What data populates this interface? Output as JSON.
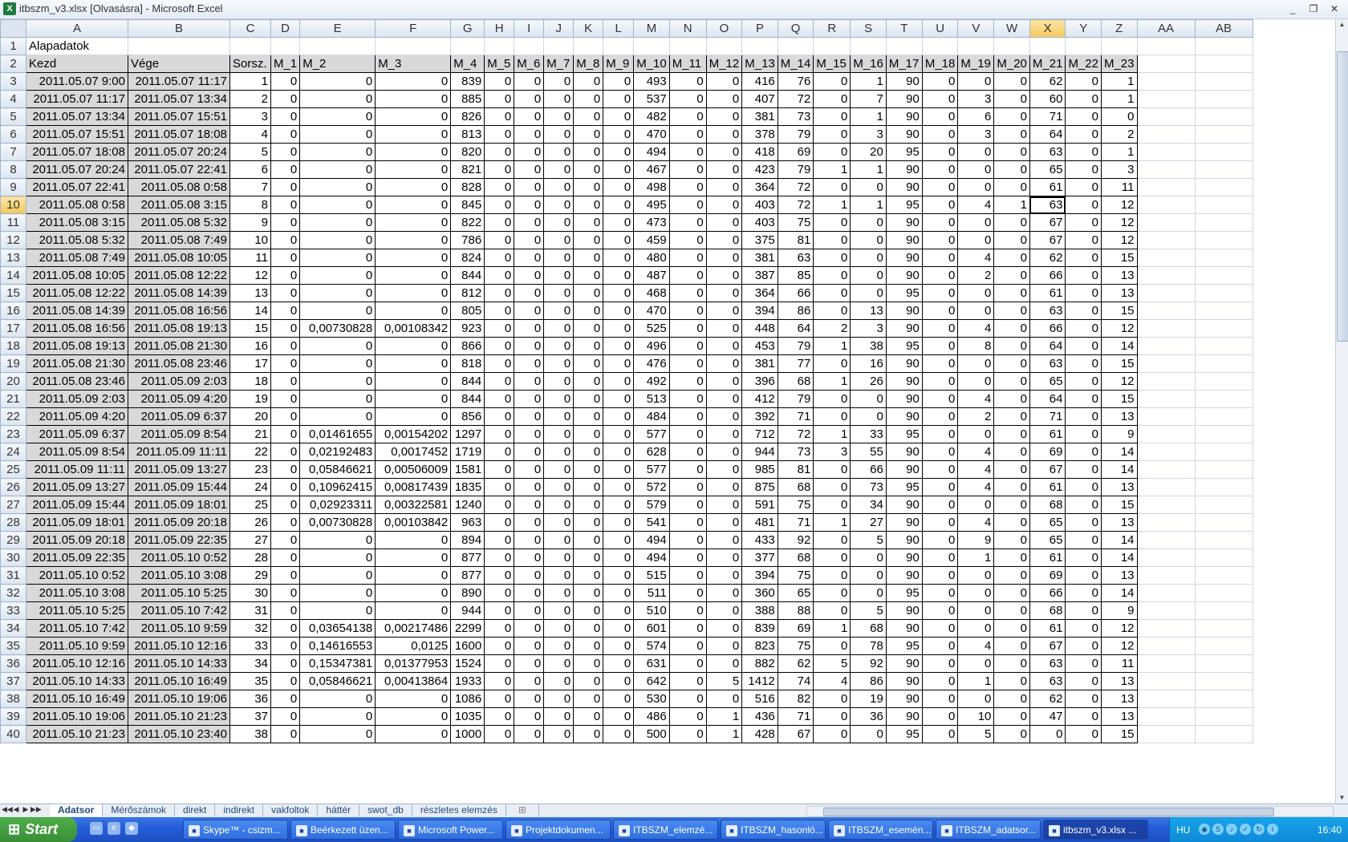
{
  "window": {
    "title": "itbszm_v3.xlsx  [Olvasásra] - Microsoft Excel",
    "minimize": "_",
    "restore": "❐",
    "close": "✕"
  },
  "columns": [
    "A",
    "B",
    "C",
    "D",
    "E",
    "F",
    "G",
    "H",
    "I",
    "J",
    "K",
    "L",
    "M",
    "N",
    "O",
    "P",
    "Q",
    "R",
    "S",
    "T",
    "U",
    "V",
    "W",
    "X",
    "Y",
    "Z",
    "AA",
    "AB"
  ],
  "active_column": "X",
  "active_row": "10",
  "row1": {
    "num": "1",
    "text": "Alapadatok"
  },
  "row2": {
    "num": "2",
    "headers": [
      "Kezd",
      "Vége",
      "Sorsz.",
      "M_1",
      "M_2",
      "M_3",
      "M_4",
      "M_5",
      "M_6",
      "M_7",
      "M_8",
      "M_9",
      "M_10",
      "M_11",
      "M_12",
      "M_13",
      "M_14",
      "M_15",
      "M_16",
      "M_17",
      "M_18",
      "M_19",
      "M_20",
      "M_21",
      "M_22",
      "M_23"
    ]
  },
  "rows": [
    [
      "3",
      "2011.05.07 9:00",
      "2011.05.07 11:17",
      "1",
      "0",
      "0",
      "0",
      "839",
      "0",
      "0",
      "0",
      "0",
      "0",
      "493",
      "0",
      "0",
      "416",
      "76",
      "0",
      "1",
      "90",
      "0",
      "0",
      "0",
      "62",
      "0",
      "1"
    ],
    [
      "4",
      "2011.05.07 11:17",
      "2011.05.07 13:34",
      "2",
      "0",
      "0",
      "0",
      "885",
      "0",
      "0",
      "0",
      "0",
      "0",
      "537",
      "0",
      "0",
      "407",
      "72",
      "0",
      "7",
      "90",
      "0",
      "3",
      "0",
      "60",
      "0",
      "1"
    ],
    [
      "5",
      "2011.05.07 13:34",
      "2011.05.07 15:51",
      "3",
      "0",
      "0",
      "0",
      "826",
      "0",
      "0",
      "0",
      "0",
      "0",
      "482",
      "0",
      "0",
      "381",
      "73",
      "0",
      "1",
      "90",
      "0",
      "6",
      "0",
      "71",
      "0",
      "0"
    ],
    [
      "6",
      "2011.05.07 15:51",
      "2011.05.07 18:08",
      "4",
      "0",
      "0",
      "0",
      "813",
      "0",
      "0",
      "0",
      "0",
      "0",
      "470",
      "0",
      "0",
      "378",
      "79",
      "0",
      "3",
      "90",
      "0",
      "3",
      "0",
      "64",
      "0",
      "2"
    ],
    [
      "7",
      "2011.05.07 18:08",
      "2011.05.07 20:24",
      "5",
      "0",
      "0",
      "0",
      "820",
      "0",
      "0",
      "0",
      "0",
      "0",
      "494",
      "0",
      "0",
      "418",
      "69",
      "0",
      "20",
      "95",
      "0",
      "0",
      "0",
      "63",
      "0",
      "1"
    ],
    [
      "8",
      "2011.05.07 20:24",
      "2011.05.07 22:41",
      "6",
      "0",
      "0",
      "0",
      "821",
      "0",
      "0",
      "0",
      "0",
      "0",
      "467",
      "0",
      "0",
      "423",
      "79",
      "1",
      "1",
      "90",
      "0",
      "0",
      "0",
      "65",
      "0",
      "3"
    ],
    [
      "9",
      "2011.05.07 22:41",
      "2011.05.08 0:58",
      "7",
      "0",
      "0",
      "0",
      "828",
      "0",
      "0",
      "0",
      "0",
      "0",
      "498",
      "0",
      "0",
      "364",
      "72",
      "0",
      "0",
      "90",
      "0",
      "0",
      "0",
      "61",
      "0",
      "11"
    ],
    [
      "10",
      "2011.05.08 0:58",
      "2011.05.08 3:15",
      "8",
      "0",
      "0",
      "0",
      "845",
      "0",
      "0",
      "0",
      "0",
      "0",
      "495",
      "0",
      "0",
      "403",
      "72",
      "1",
      "1",
      "95",
      "0",
      "4",
      "1",
      "63",
      "0",
      "12"
    ],
    [
      "11",
      "2011.05.08 3:15",
      "2011.05.08 5:32",
      "9",
      "0",
      "0",
      "0",
      "822",
      "0",
      "0",
      "0",
      "0",
      "0",
      "473",
      "0",
      "0",
      "403",
      "75",
      "0",
      "0",
      "90",
      "0",
      "0",
      "0",
      "67",
      "0",
      "12"
    ],
    [
      "12",
      "2011.05.08 5:32",
      "2011.05.08 7:49",
      "10",
      "0",
      "0",
      "0",
      "786",
      "0",
      "0",
      "0",
      "0",
      "0",
      "459",
      "0",
      "0",
      "375",
      "81",
      "0",
      "0",
      "90",
      "0",
      "0",
      "0",
      "67",
      "0",
      "12"
    ],
    [
      "13",
      "2011.05.08 7:49",
      "2011.05.08 10:05",
      "11",
      "0",
      "0",
      "0",
      "824",
      "0",
      "0",
      "0",
      "0",
      "0",
      "480",
      "0",
      "0",
      "381",
      "63",
      "0",
      "0",
      "90",
      "0",
      "4",
      "0",
      "62",
      "0",
      "15"
    ],
    [
      "14",
      "2011.05.08 10:05",
      "2011.05.08 12:22",
      "12",
      "0",
      "0",
      "0",
      "844",
      "0",
      "0",
      "0",
      "0",
      "0",
      "487",
      "0",
      "0",
      "387",
      "85",
      "0",
      "0",
      "90",
      "0",
      "2",
      "0",
      "66",
      "0",
      "13"
    ],
    [
      "15",
      "2011.05.08 12:22",
      "2011.05.08 14:39",
      "13",
      "0",
      "0",
      "0",
      "812",
      "0",
      "0",
      "0",
      "0",
      "0",
      "468",
      "0",
      "0",
      "364",
      "66",
      "0",
      "0",
      "95",
      "0",
      "0",
      "0",
      "61",
      "0",
      "13"
    ],
    [
      "16",
      "2011.05.08 14:39",
      "2011.05.08 16:56",
      "14",
      "0",
      "0",
      "0",
      "805",
      "0",
      "0",
      "0",
      "0",
      "0",
      "470",
      "0",
      "0",
      "394",
      "86",
      "0",
      "13",
      "90",
      "0",
      "0",
      "0",
      "63",
      "0",
      "15"
    ],
    [
      "17",
      "2011.05.08 16:56",
      "2011.05.08 19:13",
      "15",
      "0",
      "0,00730828",
      "0,00108342",
      "923",
      "0",
      "0",
      "0",
      "0",
      "0",
      "525",
      "0",
      "0",
      "448",
      "64",
      "2",
      "3",
      "90",
      "0",
      "4",
      "0",
      "66",
      "0",
      "12"
    ],
    [
      "18",
      "2011.05.08 19:13",
      "2011.05.08 21:30",
      "16",
      "0",
      "0",
      "0",
      "866",
      "0",
      "0",
      "0",
      "0",
      "0",
      "496",
      "0",
      "0",
      "453",
      "79",
      "1",
      "38",
      "95",
      "0",
      "8",
      "0",
      "64",
      "0",
      "14"
    ],
    [
      "19",
      "2011.05.08 21:30",
      "2011.05.08 23:46",
      "17",
      "0",
      "0",
      "0",
      "818",
      "0",
      "0",
      "0",
      "0",
      "0",
      "476",
      "0",
      "0",
      "381",
      "77",
      "0",
      "16",
      "90",
      "0",
      "0",
      "0",
      "63",
      "0",
      "15"
    ],
    [
      "20",
      "2011.05.08 23:46",
      "2011.05.09 2:03",
      "18",
      "0",
      "0",
      "0",
      "844",
      "0",
      "0",
      "0",
      "0",
      "0",
      "492",
      "0",
      "0",
      "396",
      "68",
      "1",
      "26",
      "90",
      "0",
      "0",
      "0",
      "65",
      "0",
      "12"
    ],
    [
      "21",
      "2011.05.09 2:03",
      "2011.05.09 4:20",
      "19",
      "0",
      "0",
      "0",
      "844",
      "0",
      "0",
      "0",
      "0",
      "0",
      "513",
      "0",
      "0",
      "412",
      "79",
      "0",
      "0",
      "90",
      "0",
      "4",
      "0",
      "64",
      "0",
      "15"
    ],
    [
      "22",
      "2011.05.09 4:20",
      "2011.05.09 6:37",
      "20",
      "0",
      "0",
      "0",
      "856",
      "0",
      "0",
      "0",
      "0",
      "0",
      "484",
      "0",
      "0",
      "392",
      "71",
      "0",
      "0",
      "90",
      "0",
      "2",
      "0",
      "71",
      "0",
      "13"
    ],
    [
      "23",
      "2011.05.09 6:37",
      "2011.05.09 8:54",
      "21",
      "0",
      "0,01461655",
      "0,00154202",
      "1297",
      "0",
      "0",
      "0",
      "0",
      "0",
      "577",
      "0",
      "0",
      "712",
      "72",
      "1",
      "33",
      "95",
      "0",
      "0",
      "0",
      "61",
      "0",
      "9"
    ],
    [
      "24",
      "2011.05.09 8:54",
      "2011.05.09 11:11",
      "22",
      "0",
      "0,02192483",
      "0,0017452",
      "1719",
      "0",
      "0",
      "0",
      "0",
      "0",
      "628",
      "0",
      "0",
      "944",
      "73",
      "3",
      "55",
      "90",
      "0",
      "4",
      "0",
      "69",
      "0",
      "14"
    ],
    [
      "25",
      "2011.05.09 11:11",
      "2011.05.09 13:27",
      "23",
      "0",
      "0,05846621",
      "0,00506009",
      "1581",
      "0",
      "0",
      "0",
      "0",
      "0",
      "577",
      "0",
      "0",
      "985",
      "81",
      "0",
      "66",
      "90",
      "0",
      "4",
      "0",
      "67",
      "0",
      "14"
    ],
    [
      "26",
      "2011.05.09 13:27",
      "2011.05.09 15:44",
      "24",
      "0",
      "0,10962415",
      "0,00817439",
      "1835",
      "0",
      "0",
      "0",
      "0",
      "0",
      "572",
      "0",
      "0",
      "875",
      "68",
      "0",
      "73",
      "95",
      "0",
      "4",
      "0",
      "61",
      "0",
      "13"
    ],
    [
      "27",
      "2011.05.09 15:44",
      "2011.05.09 18:01",
      "25",
      "0",
      "0,02923311",
      "0,00322581",
      "1240",
      "0",
      "0",
      "0",
      "0",
      "0",
      "579",
      "0",
      "0",
      "591",
      "75",
      "0",
      "34",
      "90",
      "0",
      "0",
      "0",
      "68",
      "0",
      "15"
    ],
    [
      "28",
      "2011.05.09 18:01",
      "2011.05.09 20:18",
      "26",
      "0",
      "0,00730828",
      "0,00103842",
      "963",
      "0",
      "0",
      "0",
      "0",
      "0",
      "541",
      "0",
      "0",
      "481",
      "71",
      "1",
      "27",
      "90",
      "0",
      "4",
      "0",
      "65",
      "0",
      "13"
    ],
    [
      "29",
      "2011.05.09 20:18",
      "2011.05.09 22:35",
      "27",
      "0",
      "0",
      "0",
      "894",
      "0",
      "0",
      "0",
      "0",
      "0",
      "494",
      "0",
      "0",
      "433",
      "92",
      "0",
      "5",
      "90",
      "0",
      "9",
      "0",
      "65",
      "0",
      "14"
    ],
    [
      "30",
      "2011.05.09 22:35",
      "2011.05.10 0:52",
      "28",
      "0",
      "0",
      "0",
      "877",
      "0",
      "0",
      "0",
      "0",
      "0",
      "494",
      "0",
      "0",
      "377",
      "68",
      "0",
      "0",
      "90",
      "0",
      "1",
      "0",
      "61",
      "0",
      "14"
    ],
    [
      "31",
      "2011.05.10 0:52",
      "2011.05.10 3:08",
      "29",
      "0",
      "0",
      "0",
      "877",
      "0",
      "0",
      "0",
      "0",
      "0",
      "515",
      "0",
      "0",
      "394",
      "75",
      "0",
      "0",
      "90",
      "0",
      "0",
      "0",
      "69",
      "0",
      "13"
    ],
    [
      "32",
      "2011.05.10 3:08",
      "2011.05.10 5:25",
      "30",
      "0",
      "0",
      "0",
      "890",
      "0",
      "0",
      "0",
      "0",
      "0",
      "511",
      "0",
      "0",
      "360",
      "65",
      "0",
      "0",
      "95",
      "0",
      "0",
      "0",
      "66",
      "0",
      "14"
    ],
    [
      "33",
      "2011.05.10 5:25",
      "2011.05.10 7:42",
      "31",
      "0",
      "0",
      "0",
      "944",
      "0",
      "0",
      "0",
      "0",
      "0",
      "510",
      "0",
      "0",
      "388",
      "88",
      "0",
      "5",
      "90",
      "0",
      "0",
      "0",
      "68",
      "0",
      "9"
    ],
    [
      "34",
      "2011.05.10 7:42",
      "2011.05.10 9:59",
      "32",
      "0",
      "0,03654138",
      "0,00217486",
      "2299",
      "0",
      "0",
      "0",
      "0",
      "0",
      "601",
      "0",
      "0",
      "839",
      "69",
      "1",
      "68",
      "90",
      "0",
      "0",
      "0",
      "61",
      "0",
      "12"
    ],
    [
      "35",
      "2011.05.10 9:59",
      "2011.05.10 12:16",
      "33",
      "0",
      "0,14616553",
      "0,0125",
      "1600",
      "0",
      "0",
      "0",
      "0",
      "0",
      "574",
      "0",
      "0",
      "823",
      "75",
      "0",
      "78",
      "95",
      "0",
      "4",
      "0",
      "67",
      "0",
      "12"
    ],
    [
      "36",
      "2011.05.10 12:16",
      "2011.05.10 14:33",
      "34",
      "0",
      "0,15347381",
      "0,01377953",
      "1524",
      "0",
      "0",
      "0",
      "0",
      "0",
      "631",
      "0",
      "0",
      "882",
      "62",
      "5",
      "92",
      "90",
      "0",
      "0",
      "0",
      "63",
      "0",
      "11"
    ],
    [
      "37",
      "2011.05.10 14:33",
      "2011.05.10 16:49",
      "35",
      "0",
      "0,05846621",
      "0,00413864",
      "1933",
      "0",
      "0",
      "0",
      "0",
      "0",
      "642",
      "0",
      "5",
      "1412",
      "74",
      "4",
      "86",
      "90",
      "0",
      "1",
      "0",
      "63",
      "0",
      "13"
    ],
    [
      "38",
      "2011.05.10 16:49",
      "2011.05.10 19:06",
      "36",
      "0",
      "0",
      "0",
      "1086",
      "0",
      "0",
      "0",
      "0",
      "0",
      "530",
      "0",
      "0",
      "516",
      "82",
      "0",
      "19",
      "90",
      "0",
      "0",
      "0",
      "62",
      "0",
      "13"
    ],
    [
      "39",
      "2011.05.10 19:06",
      "2011.05.10 21:23",
      "37",
      "0",
      "0",
      "0",
      "1035",
      "0",
      "0",
      "0",
      "0",
      "0",
      "486",
      "0",
      "1",
      "436",
      "71",
      "0",
      "36",
      "90",
      "0",
      "10",
      "0",
      "47",
      "0",
      "13"
    ],
    [
      "40",
      "2011.05.10 21:23",
      "2011.05.10 23:40",
      "38",
      "0",
      "0",
      "0",
      "1000",
      "0",
      "0",
      "0",
      "0",
      "0",
      "500",
      "0",
      "1",
      "428",
      "67",
      "0",
      "0",
      "95",
      "0",
      "5",
      "0",
      "0",
      "0",
      "15"
    ]
  ],
  "sheet_tabs": [
    "Adatsor",
    "Mérőszámok",
    "direkt",
    "indirekt",
    "vakfoltok",
    "háttér",
    "swot_db",
    "részletes elemzés"
  ],
  "active_tab": "Adatsor",
  "taskbar": {
    "start": "Start",
    "tasks": [
      "Skype™ - csizm...",
      "Beérkezett üzen...",
      "Microsoft Power...",
      "Projektdokumen...",
      "ITBSZM_elemzé...",
      "ITBSZM_hasonló...",
      "ITBSZM_esemén...",
      "ITBSZM_adatsor...",
      "itbszm_v3.xlsx ..."
    ],
    "active_task": "itbszm_v3.xlsx ...",
    "lang": "HU",
    "clock": "16:40"
  }
}
